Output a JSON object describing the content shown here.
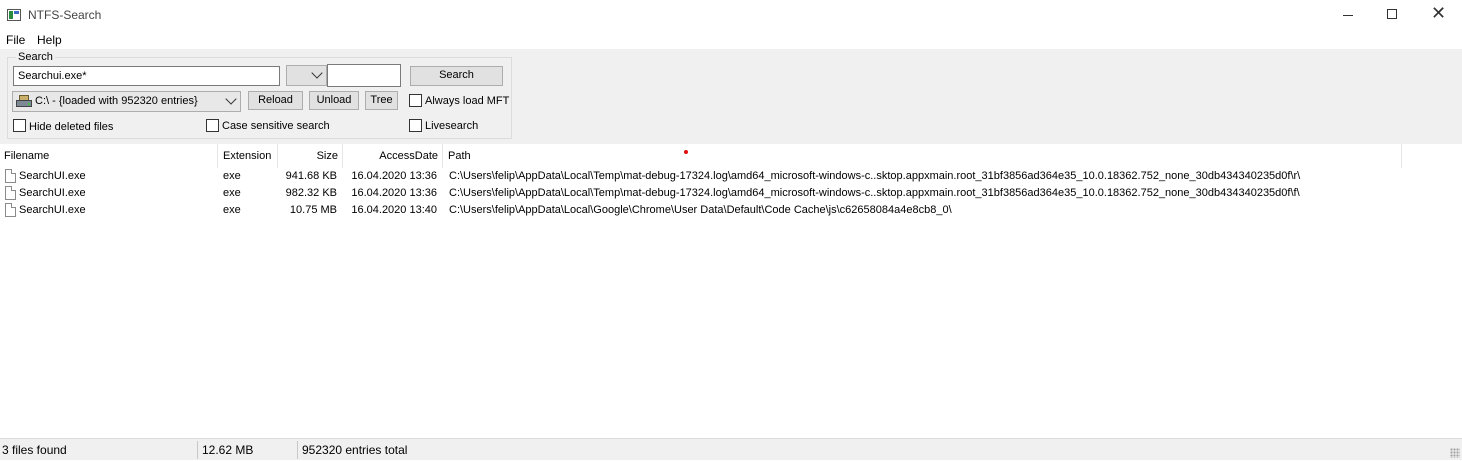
{
  "window": {
    "title": "NTFS-Search",
    "minimize_icon": "minimize-icon",
    "maximize_icon": "maximize-icon",
    "close_glyph": "✕"
  },
  "menu": {
    "file": "File",
    "help": "Help"
  },
  "search": {
    "group_label": "Search",
    "query_value": "Searchui.exe*",
    "filter_combo_value": "",
    "filter_text_value": "",
    "search_button": "Search",
    "drive_value": "C:\\ - {loaded with 952320 entries}",
    "reload_button": "Reload",
    "unload_button": "Unload",
    "tree_button": "Tree",
    "always_load_mft": {
      "label": "Always load MFT",
      "checked": false
    },
    "hide_deleted": {
      "label": "Hide deleted files",
      "checked": false
    },
    "case_sensitive": {
      "label": "Case sensitive search",
      "checked": false
    },
    "livesearch": {
      "label": "Livesearch",
      "checked": false
    }
  },
  "table": {
    "columns": [
      "Filename",
      "Extension",
      "Size",
      "AccessDate",
      "Path"
    ],
    "rows": [
      {
        "filename": "SearchUI.exe",
        "extension": "exe",
        "size": "941.68 KB",
        "access_date": "16.04.2020 13:36",
        "path": "C:\\Users\\felip\\AppData\\Local\\Temp\\mat-debug-17324.log\\amd64_microsoft-windows-c..sktop.appxmain.root_31bf3856ad364e35_10.0.18362.752_none_30db434340235d0f\\r\\"
      },
      {
        "filename": "SearchUI.exe",
        "extension": "exe",
        "size": "982.32 KB",
        "access_date": "16.04.2020 13:36",
        "path": "C:\\Users\\felip\\AppData\\Local\\Temp\\mat-debug-17324.log\\amd64_microsoft-windows-c..sktop.appxmain.root_31bf3856ad364e35_10.0.18362.752_none_30db434340235d0f\\f\\"
      },
      {
        "filename": "SearchUI.exe",
        "extension": "exe",
        "size": "10.75 MB",
        "access_date": "16.04.2020 13:40",
        "path": "C:\\Users\\felip\\AppData\\Local\\Google\\Chrome\\User Data\\Default\\Code Cache\\js\\c62658084a4e8cb8_0\\"
      }
    ]
  },
  "status": {
    "files_found": "3 files found",
    "total_size": "12.62 MB",
    "entries_total": "952320 entries total"
  },
  "colors": {
    "toolbar_bg": "#f0f0f0",
    "marker_dot": "#e01010"
  }
}
